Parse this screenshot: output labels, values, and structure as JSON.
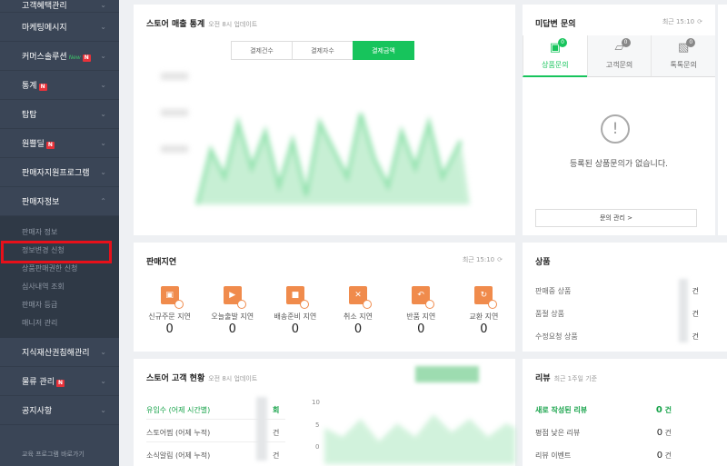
{
  "sidebar": {
    "items": [
      {
        "label": "고객혜택관리"
      },
      {
        "label": "마케팅메시지"
      },
      {
        "label": "커머스솔루션",
        "tag": "New",
        "badge": "N"
      },
      {
        "label": "통계",
        "badge": "N"
      },
      {
        "label": "탑탑"
      },
      {
        "label": "원쁠딜",
        "badge": "N"
      },
      {
        "label": "판매자지원프로그램"
      },
      {
        "label": "판매자정보",
        "expanded": true
      }
    ],
    "sub_items": [
      "판매자 정보",
      "정보변경 신청",
      "상품판매권한 신청",
      "심사내역 조회",
      "판매자 등급",
      "매니저 관리"
    ],
    "items_after": [
      {
        "label": "지식재산권침해관리"
      },
      {
        "label": "물류 관리",
        "badge": "N"
      },
      {
        "label": "공지사항"
      }
    ],
    "bottom_link": "교육 프로그램 바로가기"
  },
  "sales": {
    "title": "스토어 매출 통계",
    "updated": "오전 8시 업데이트",
    "tabs": [
      "결제건수",
      "결제자수",
      "결제금액"
    ],
    "active_tab": "결제금액"
  },
  "inquiry": {
    "title": "미답변 문의",
    "updated": "최근 15:10",
    "tabs": [
      {
        "label": "상품문의",
        "count": "0",
        "icon": "box-icon"
      },
      {
        "label": "고객문의",
        "count": "0",
        "icon": "bell-icon"
      },
      {
        "label": "톡톡문의",
        "count": "0",
        "icon": "chat-icon"
      }
    ],
    "empty_message": "등록된 상품문의가 없습니다.",
    "manage_button": "문의 관리 >"
  },
  "delay": {
    "title": "판매지연",
    "updated": "최근 15:10",
    "items": [
      {
        "label": "신규주문 지연",
        "value": "0",
        "icon": "gift-icon"
      },
      {
        "label": "오늘출발 지연",
        "value": "0",
        "icon": "truck-fast-icon"
      },
      {
        "label": "배송준비 지연",
        "value": "0",
        "icon": "truck-icon"
      },
      {
        "label": "취소 지연",
        "value": "0",
        "icon": "cancel-icon"
      },
      {
        "label": "반품 지연",
        "value": "0",
        "icon": "return-icon"
      },
      {
        "label": "교환 지연",
        "value": "0",
        "icon": "exchange-icon"
      }
    ]
  },
  "product": {
    "title": "상품",
    "rows": [
      {
        "label": "판매중 상품",
        "unit": "건"
      },
      {
        "label": "품절 상품",
        "unit": "건"
      },
      {
        "label": "수정요청 상품",
        "unit": "건"
      }
    ]
  },
  "customer": {
    "title": "스토어 고객 현황",
    "updated": "오전 8시 업데이트",
    "rows": [
      {
        "label": "유입수 (어제 시간별)",
        "unit": "회"
      },
      {
        "label": "스토어찜 (어제 누적)",
        "unit": "건"
      },
      {
        "label": "소식알림 (어제 누적)",
        "unit": "건"
      }
    ],
    "y_ticks": [
      "10",
      "5",
      "0"
    ]
  },
  "review": {
    "title": "리뷰",
    "subtitle": "최근 1주일 기준",
    "rows": [
      {
        "label": "새로 작성된 리뷰",
        "value": "0",
        "unit": "건"
      },
      {
        "label": "평점 낮은 리뷰",
        "value": "0",
        "unit": "건"
      },
      {
        "label": "리뷰 이벤트",
        "value": "0",
        "unit": "건"
      }
    ]
  }
}
